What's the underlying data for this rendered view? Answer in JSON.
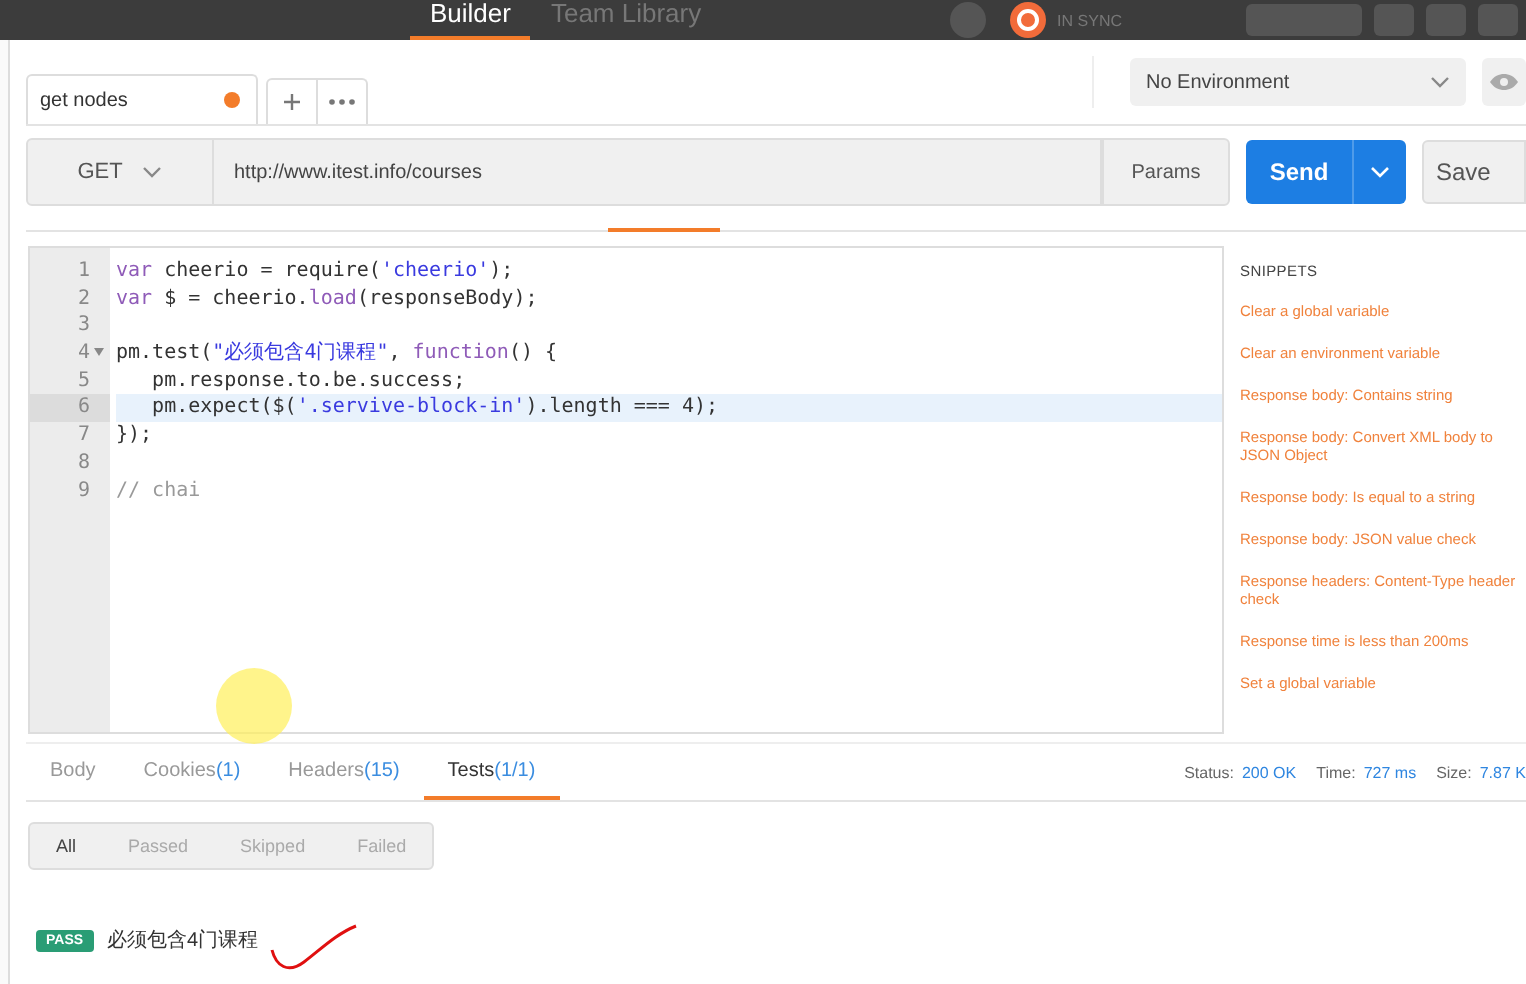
{
  "header": {
    "tabs": [
      {
        "label": "Builder",
        "selected": true
      },
      {
        "label": "Team Library",
        "selected": false
      }
    ],
    "sync_status": "IN SYNC"
  },
  "request_tabs": [
    {
      "label": "get nodes",
      "unsaved": true,
      "selected": true
    }
  ],
  "environment": {
    "value": "No Environment"
  },
  "request": {
    "method": "GET",
    "url": "http://www.itest.info/courses",
    "params_label": "Params",
    "send_label": "Send",
    "save_label": "Save"
  },
  "editor": {
    "lines": [
      {
        "number": "1",
        "selected": false,
        "tokens": [
          {
            "kind": "keyword",
            "text": "var"
          },
          {
            "kind": "plain",
            "text": " cheerio = require("
          },
          {
            "kind": "string",
            "text": "'cheerio'"
          },
          {
            "kind": "plain",
            "text": ");"
          }
        ]
      },
      {
        "number": "2",
        "selected": false,
        "tokens": [
          {
            "kind": "keyword",
            "text": "var"
          },
          {
            "kind": "plain",
            "text": " $ = cheerio."
          },
          {
            "kind": "keyword",
            "text": "load"
          },
          {
            "kind": "plain",
            "text": "(responseBody);"
          }
        ]
      },
      {
        "number": "3",
        "selected": false
      },
      {
        "number": "4",
        "foldable": true,
        "selected": false,
        "tokens": [
          {
            "kind": "plain",
            "text": "pm.test("
          },
          {
            "kind": "string",
            "text": "\"必须包含4门课程\""
          },
          {
            "kind": "plain",
            "text": ", "
          },
          {
            "kind": "keyword",
            "text": "function"
          },
          {
            "kind": "plain",
            "text": "() {"
          }
        ]
      },
      {
        "number": "5",
        "selected": false,
        "tokens": [
          {
            "kind": "plain",
            "text": "   pm.response.to.be.success;"
          }
        ]
      },
      {
        "number": "6",
        "selected": true,
        "tokens": [
          {
            "kind": "plain",
            "text": "   pm.expect($("
          },
          {
            "kind": "string",
            "text": "'.servive-block-in'"
          },
          {
            "kind": "plain",
            "text": ").length === 4);"
          }
        ]
      },
      {
        "number": "7",
        "selected": false,
        "tokens": [
          {
            "kind": "plain",
            "text": "});"
          }
        ]
      },
      {
        "number": "8",
        "selected": false
      },
      {
        "number": "9",
        "selected": false,
        "tokens": [
          {
            "kind": "comment",
            "text": "// chai"
          }
        ]
      }
    ]
  },
  "snippets": {
    "title": "SNIPPETS",
    "items": [
      "Clear a global variable",
      "Clear an environment variable",
      "Response body: Contains string",
      "Response body: Convert XML body to JSON Object",
      "Response body: Is equal to a string",
      "Response body: JSON value check",
      "Response headers: Content-Type header check",
      "Response time is less than 200ms",
      "Set a global variable"
    ]
  },
  "response_tabs": [
    {
      "label": "Body",
      "selected": false
    },
    {
      "label": "Cookies",
      "count": "(1)",
      "selected": false
    },
    {
      "label": "Headers",
      "count": "(15)",
      "selected": false
    },
    {
      "label": "Tests",
      "count": "(1/1)",
      "selected": true
    }
  ],
  "response_meta": [
    {
      "label": "Status:",
      "value": "200 OK"
    },
    {
      "label": "Time:",
      "value": "727 ms"
    },
    {
      "label": "Size:",
      "value": "7.87 K"
    }
  ],
  "test_filters": [
    {
      "label": "All",
      "selected": true
    },
    {
      "label": "Passed",
      "selected": false
    },
    {
      "label": "Skipped",
      "selected": false
    },
    {
      "label": "Failed",
      "selected": false
    }
  ],
  "test_results": [
    {
      "status": "PASS",
      "kind": "pass",
      "name": "必须包含4门课程"
    }
  ]
}
